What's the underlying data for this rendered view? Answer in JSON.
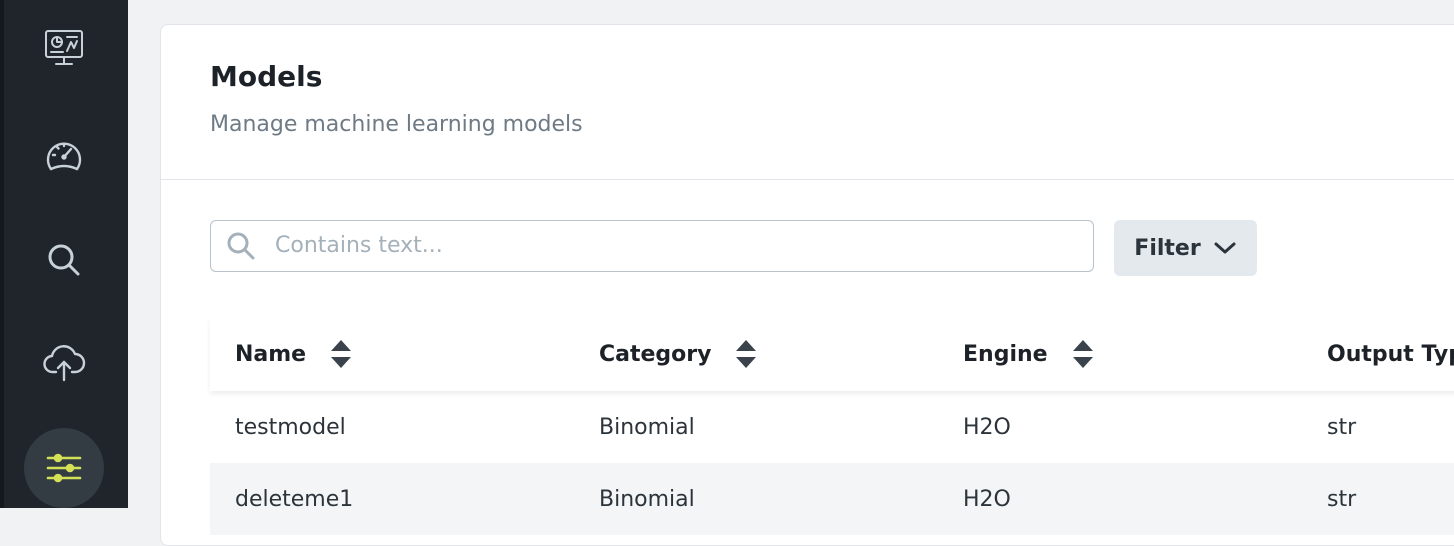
{
  "sidebar": {
    "items": [
      {
        "icon": "monitor-chart-icon",
        "active": false
      },
      {
        "icon": "speedometer-icon",
        "active": false
      },
      {
        "icon": "search-icon",
        "active": false
      },
      {
        "icon": "cloud-upload-icon",
        "active": false
      },
      {
        "icon": "sliders-icon",
        "active": true
      }
    ],
    "active_color": "#d4e157"
  },
  "header": {
    "title": "Models",
    "subtitle": "Manage machine learning models"
  },
  "search": {
    "placeholder": "Contains text...",
    "value": ""
  },
  "filter": {
    "label": "Filter"
  },
  "table": {
    "columns": [
      "Name",
      "Category",
      "Engine",
      "Output Typ"
    ],
    "rows": [
      [
        "testmodel",
        "Binomial",
        "H2O",
        "str"
      ],
      [
        "deleteme1",
        "Binomial",
        "H2O",
        "str"
      ]
    ]
  }
}
